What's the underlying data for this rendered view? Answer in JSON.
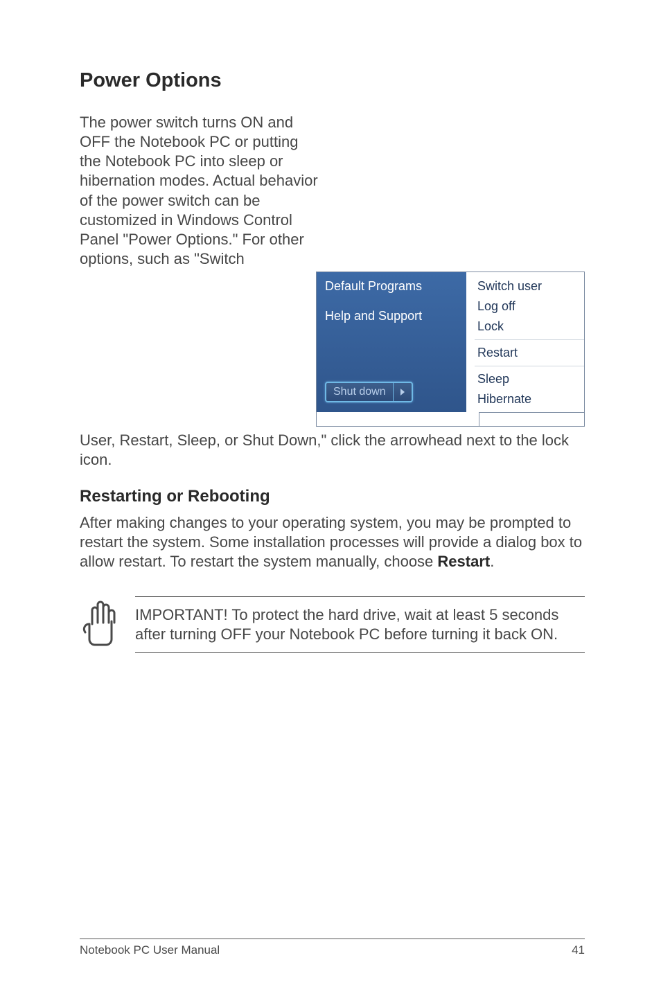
{
  "heading": "Power Options",
  "para_left": "The power switch turns ON and OFF the Notebook PC or putting the Notebook PC into sleep or hibernation modes. Actual behavior of the power switch can be customized in Windows Control Panel \"Power Options.\" For other options, such as \"Switch",
  "para_after": "User, Restart, Sleep, or Shut Down,\" click the arrowhead next to the lock icon.",
  "sub_heading": "Restarting or Rebooting",
  "restart_para_a": "After making changes to your operating system, you may be prompted to restart the system. Some installation processes will provide a dialog box to allow restart. To restart the system manually, choose ",
  "restart_bold": "Restart",
  "restart_para_b": ".",
  "callout": "IMPORTANT!  To protect the hard drive, wait at least 5 seconds after turning OFF your Notebook PC before turning it back ON.",
  "screenshot": {
    "links": {
      "default_programs": "Default Programs",
      "help_support": "Help and Support"
    },
    "shutdown_label": "Shut down",
    "menu": {
      "switch_user": "Switch user",
      "log_off": "Log off",
      "lock": "Lock",
      "restart": "Restart",
      "sleep": "Sleep",
      "hibernate": "Hibernate"
    }
  },
  "footer": {
    "left": "Notebook PC User Manual",
    "right": "41"
  }
}
